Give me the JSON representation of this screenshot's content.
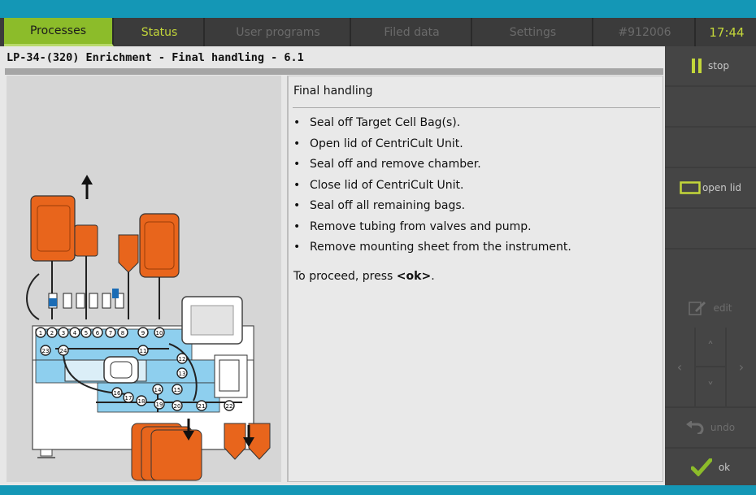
{
  "tabs": [
    {
      "label": "Processes"
    },
    {
      "label": "Status"
    },
    {
      "label": "User programs"
    },
    {
      "label": "Filed data"
    },
    {
      "label": "Settings"
    },
    {
      "label": "#912006"
    },
    {
      "label": "17:44"
    }
  ],
  "page": {
    "title": "LP-34-(320) Enrichment - Final handling - 6.1"
  },
  "instructions": {
    "heading": "Final handling",
    "bullet": "•",
    "steps": [
      "Seal off Target Cell Bag(s).",
      "Open lid of CentriCult Unit.",
      "Seal off and remove chamber.",
      "Close lid of CentriCult Unit.",
      "Seal off all remaining bags.",
      "Remove tubing from valves and pump.",
      "Remove mounting sheet from the instrument."
    ],
    "proceed_prefix": "To proceed, press ",
    "proceed_key": "<ok>",
    "proceed_suffix": "."
  },
  "sidebar": {
    "stop_label": "stop",
    "open_lid_label": "open lid",
    "edit_label": "edit",
    "undo_label": "undo",
    "ok_label": "ok"
  },
  "diagram": {
    "tubing_numbers": [
      "1",
      "2",
      "3",
      "4",
      "5",
      "6",
      "7",
      "8",
      "9",
      "10",
      "11",
      "12",
      "13",
      "14",
      "15",
      "16",
      "17",
      "18",
      "19",
      "20",
      "21",
      "22",
      "23",
      "24"
    ]
  },
  "colors": {
    "accent_blue": "#1497b6",
    "active_tab": "#8cbc2a",
    "status_text": "#c3d63a",
    "bag_orange": "#e8651c",
    "ok_check": "#8cbc2a",
    "diagram_fluid": "#8ecfee"
  }
}
